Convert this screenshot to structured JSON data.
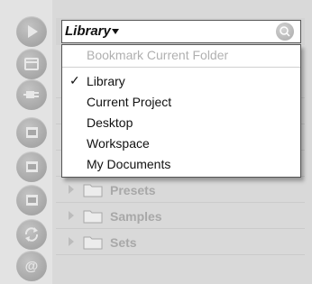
{
  "library_selector": {
    "label": "Library"
  },
  "dropdown": {
    "disabled_item": "Bookmark Current Folder",
    "items": [
      {
        "label": "Library",
        "checked": true
      },
      {
        "label": "Current Project",
        "checked": false
      },
      {
        "label": "Desktop",
        "checked": false
      },
      {
        "label": "Workspace",
        "checked": false
      },
      {
        "label": "My Documents",
        "checked": false
      }
    ],
    "check_mark": "✓"
  },
  "browser": {
    "folders": [
      {
        "label": "Presets"
      },
      {
        "label": "Samples"
      },
      {
        "label": "Sets"
      }
    ]
  },
  "sidebar": {
    "icons": [
      "play-icon",
      "browser-icon",
      "plugin-icon",
      "folder-icon",
      "folder-icon",
      "folder-icon",
      "refresh-icon",
      "at-sign-icon"
    ]
  },
  "colors": {
    "panel_bg": "#d9d9d9",
    "sidebar_button": "#a7a7a7",
    "menu_bg": "#ffffff",
    "disabled_text": "#b0b0b0"
  }
}
